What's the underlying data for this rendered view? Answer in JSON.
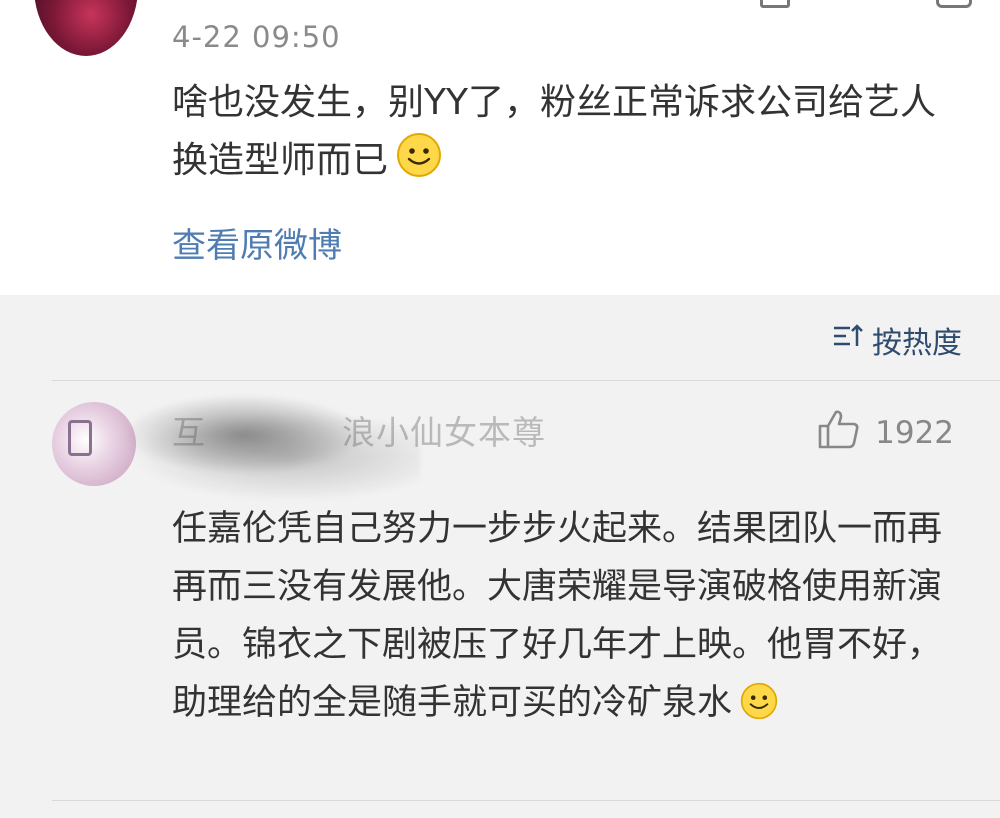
{
  "post": {
    "date": "4-22 09:50",
    "text": "啥也没发生，别YY了，粉丝正常诉求公司给艺人换造型师而已",
    "emoji": "smile-emoji",
    "view_original": "查看原微博"
  },
  "sort": {
    "label": "按热度",
    "icon": "sort-icon"
  },
  "comment": {
    "username": "互　　　　浪小仙女本尊",
    "likes": "1922",
    "like_icon": "thumbs-up-icon",
    "text": "任嘉伦凭自己努力一步步火起来。结果团队一而再再而三没有发展他。大唐荣耀是导演破格使用新演员。锦衣之下剧被压了好几年才上映。他胃不好，助理给的全是随手就可买的冷矿泉水",
    "emoji": "smile-emoji"
  },
  "colors": {
    "link": "#4f7db3",
    "sort_text": "#2f4b6e",
    "background": "#f2f2f2",
    "card": "#ffffff"
  }
}
